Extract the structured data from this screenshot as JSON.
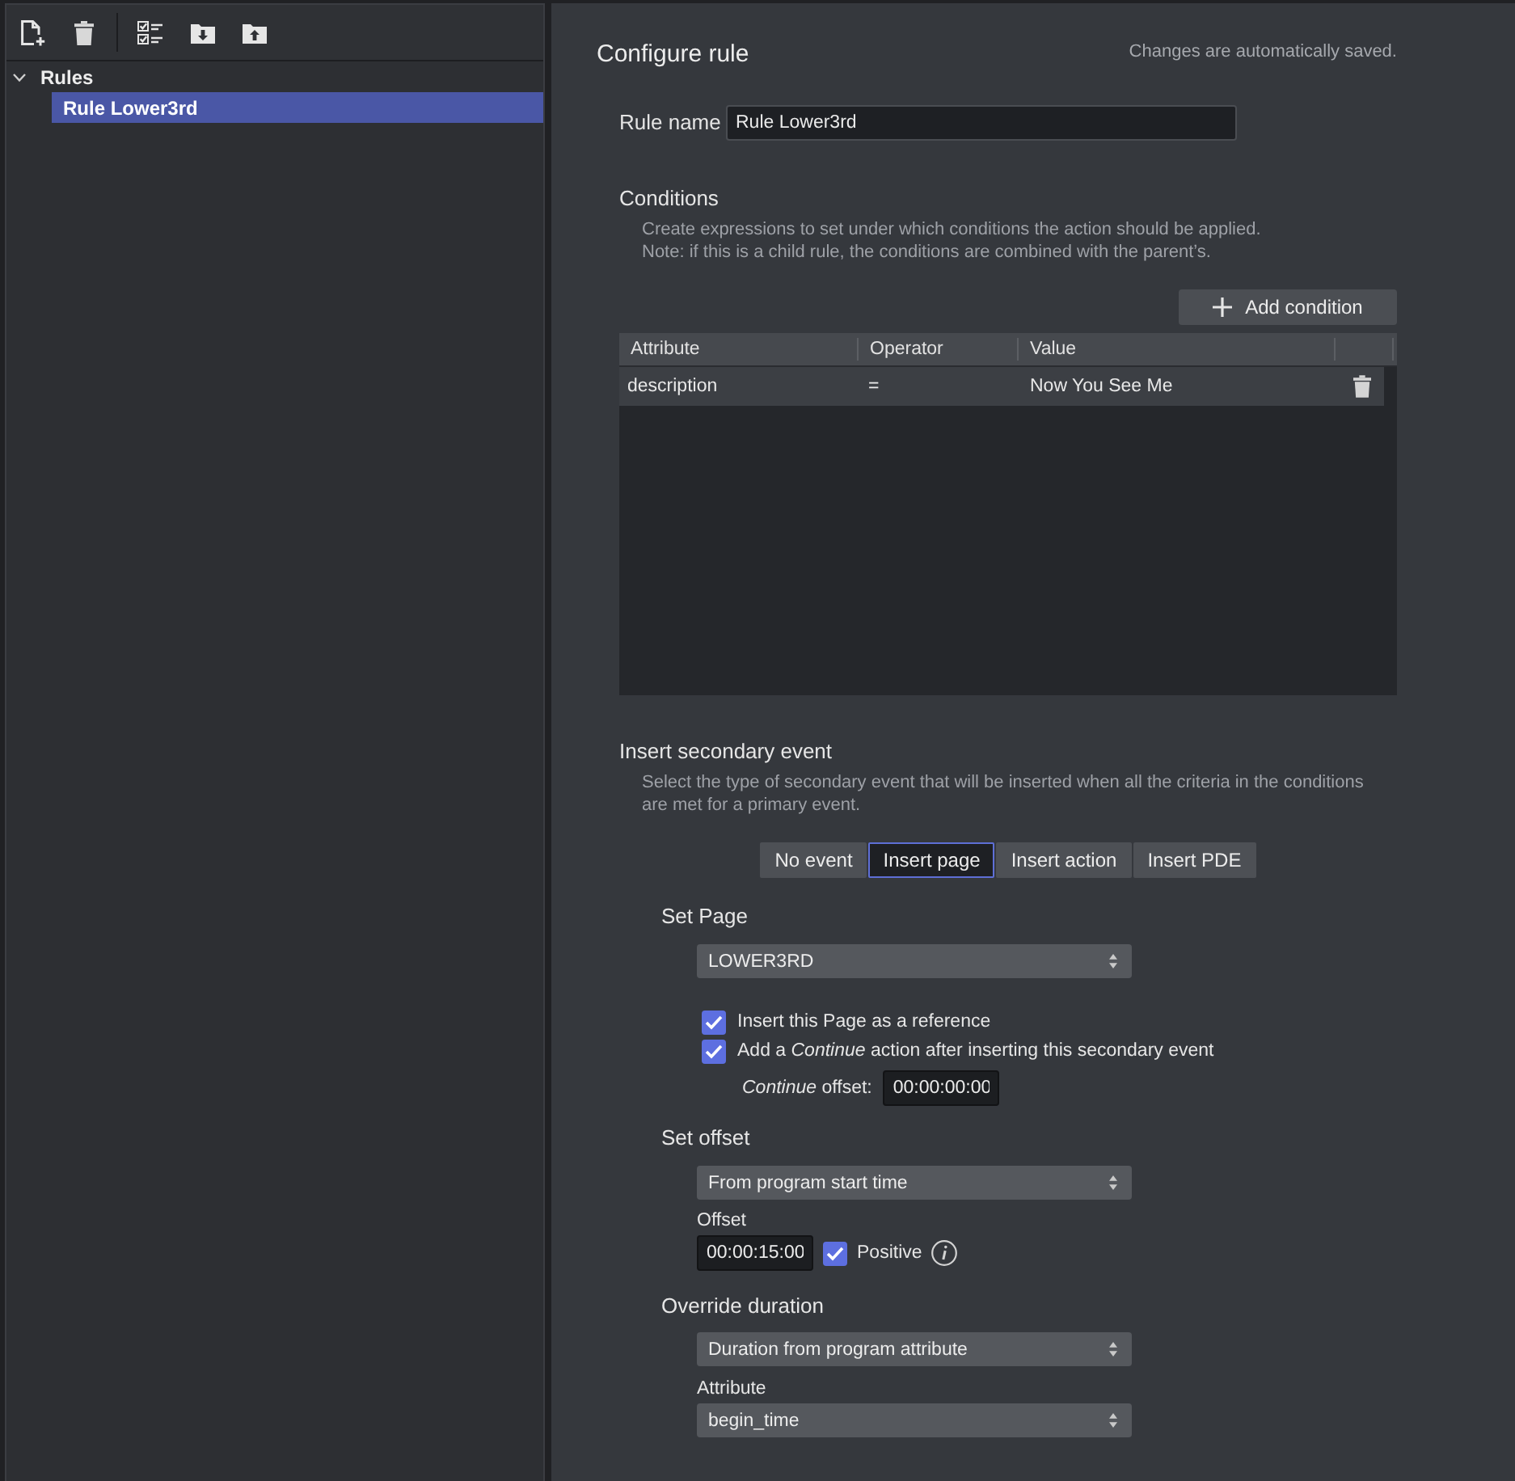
{
  "tree": [
    {
      "label": "Rules",
      "expanded": true,
      "selected": false,
      "children": [
        {
          "label": "Rule Lower3rd",
          "selected": true
        }
      ]
    }
  ],
  "header": {
    "title": "Configure rule",
    "note": "Changes are automatically saved."
  },
  "rule_name": {
    "label": "Rule name",
    "value": "Rule Lower3rd"
  },
  "conditions": {
    "title": "Conditions",
    "description": [
      "Create expressions to set under which conditions the action should be applied.",
      "Note: if this is a child rule, the conditions are combined with the parent’s."
    ],
    "add_button": "Add condition",
    "table": {
      "columns": [
        "Attribute",
        "Operator",
        "Value"
      ],
      "rows": [
        {
          "cells": [
            "description",
            "=",
            "Now You See Me"
          ]
        }
      ]
    }
  },
  "secondary_event": {
    "title": "Insert secondary event",
    "description": "Select the type of secondary event that will be inserted when all the criteria in the conditions are met for a primary event.",
    "options": [
      {
        "label": "No event",
        "selected": false
      },
      {
        "label": "Insert page",
        "selected": true
      },
      {
        "label": "Insert action",
        "selected": false
      },
      {
        "label": "Insert PDE",
        "selected": false
      }
    ]
  },
  "set_page": {
    "title": "Set Page",
    "select": "LOWER3RD",
    "checks": [
      {
        "label": "Insert this Page as a reference",
        "checked": true
      },
      {
        "label": "Add a *Continue* action after inserting this secondary event",
        "checked": true
      }
    ],
    "continue_offset": {
      "label": "*Continue* offset:",
      "value": "00:00:00:00"
    }
  },
  "set_offset": {
    "title": "Set offset",
    "select": "From program start time",
    "offset_label": "Offset",
    "offset_value": "00:00:15:00",
    "positive": {
      "label": "Positive",
      "checked": true
    }
  },
  "override_duration": {
    "title": "Override duration",
    "select": "Duration from program attribute",
    "attribute_label": "Attribute",
    "attribute_value": "begin_time"
  }
}
